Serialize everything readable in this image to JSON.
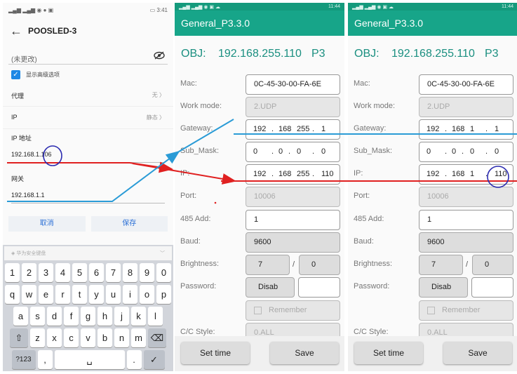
{
  "wifi": {
    "status_time": "3:41",
    "title": "POOSLED-3",
    "password_placeholder": "(未更改)",
    "show_advanced_label": "显示高级选项",
    "proxy_label": "代理",
    "proxy_value": "无 〉",
    "ip_setting_label": "IP",
    "ip_setting_value": "静态 〉",
    "ip_address_label": "IP 地址",
    "ip_address_value": "192.168.1.106",
    "gateway_label": "网关",
    "gateway_value": "192.168.1.1",
    "cancel_label": "取消",
    "save_label": "保存",
    "ime_label": "华为安全键盘",
    "keyboard": {
      "row1": [
        "1",
        "2",
        "3",
        "4",
        "5",
        "6",
        "7",
        "8",
        "9",
        "0"
      ],
      "row2": [
        "q",
        "w",
        "e",
        "r",
        "t",
        "y",
        "u",
        "i",
        "o",
        "p"
      ],
      "row3": [
        "a",
        "s",
        "d",
        "f",
        "g",
        "h",
        "j",
        "k",
        "l"
      ],
      "row4": [
        "⇧",
        "z",
        "x",
        "c",
        "v",
        "b",
        "n",
        "m",
        "⌫"
      ],
      "row5": [
        "?123",
        ",",
        "␣",
        ".",
        "✓"
      ]
    }
  },
  "before": {
    "status_time": "11:44",
    "app_title": "General_P3.3.0",
    "obj_label": "OBJ:",
    "obj_ip": "192.168.255.110",
    "obj_port": "P3",
    "mac_label": "Mac:",
    "mac_value": "0C-45-30-00-FA-6E",
    "mode_label": "Work mode:",
    "mode_value": "2.UDP",
    "gateway_label": "Gateway:",
    "gateway_value": [
      "192",
      "168",
      "255",
      "1"
    ],
    "submask_label": "Sub_Mask:",
    "submask_value": [
      "0",
      "0",
      "0",
      "0"
    ],
    "ip_label": "IP:",
    "ip_value": [
      "192",
      "168",
      "255",
      "110"
    ],
    "port_label": "Port:",
    "port_value": "10006",
    "add485_label": "485 Add:",
    "add485_value": "1",
    "baud_label": "Baud:",
    "baud_value": "9600",
    "brightness_label": "Brightness:",
    "brightness_value": "7",
    "brightness_sep": "/",
    "brightness_max": "0",
    "password_label": "Password:",
    "password_button": "Disab",
    "remember_label": "Remember",
    "cc_label": "C/C Style:",
    "cc_value": "0.ALL",
    "settime_label": "Set time",
    "save_label": "Save"
  },
  "after": {
    "status_time": "11:44",
    "app_title": "General_P3.3.0",
    "obj_label": "OBJ:",
    "obj_ip": "192.168.255.110",
    "obj_port": "P3",
    "mac_label": "Mac:",
    "mac_value": "0C-45-30-00-FA-6E",
    "mode_label": "Work mode:",
    "mode_value": "2.UDP",
    "gateway_label": "Gateway:",
    "gateway_value": [
      "192",
      "168",
      "1",
      "1"
    ],
    "submask_label": "Sub_Mask:",
    "submask_value": [
      "0",
      "0",
      "0",
      "0"
    ],
    "ip_label": "IP:",
    "ip_value": [
      "192",
      "168",
      "1",
      "110"
    ],
    "port_label": "Port:",
    "port_value": "10006",
    "add485_label": "485 Add:",
    "add485_value": "1",
    "baud_label": "Baud:",
    "baud_value": "9600",
    "brightness_label": "Brightness:",
    "brightness_value": "7",
    "brightness_sep": "/",
    "brightness_max": "0",
    "password_label": "Password:",
    "password_button": "Disab",
    "remember_label": "Remember",
    "cc_label": "C/C Style:",
    "cc_value": "0.ALL",
    "settime_label": "Set time",
    "save_label": "Save"
  },
  "colors": {
    "titlebar": "#17a589",
    "accent_text": "#1a8f80",
    "arrow_red": "#e02020",
    "arrow_blue": "#2a9bd6",
    "circle": "#2b2bb0"
  }
}
